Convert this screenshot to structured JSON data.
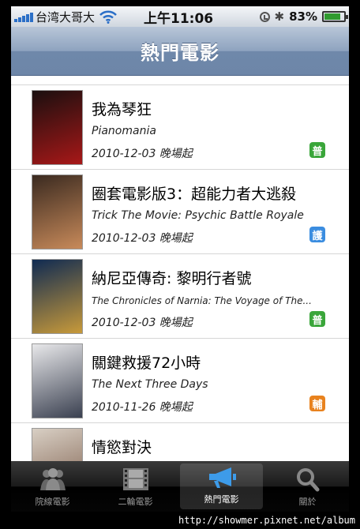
{
  "status_bar": {
    "carrier": "台湾大哥大",
    "time": "上午11:06",
    "battery_percent": "83%",
    "battery_level": 0.83
  },
  "nav": {
    "title": "熱門電影"
  },
  "movies": [
    {
      "title": "我為琴狂",
      "subtitle": "Pianomania",
      "date": "2010-12-03 晚場起",
      "rating": "普",
      "rating_color": "#3aa63a",
      "poster_colors": [
        "#1a0f0f",
        "#a81818"
      ]
    },
    {
      "title": "圈套電影版3：超能力者大逃殺",
      "subtitle": "Trick The Movie: Psychic Battle Royale",
      "date": "2010-12-03 晚場起",
      "rating": "護",
      "rating_color": "#3b8de0",
      "poster_colors": [
        "#3a2a20",
        "#c88a5a"
      ]
    },
    {
      "title": "納尼亞傳奇: 黎明行者號",
      "subtitle": "The Chronicles of Narnia: The Voyage of The...",
      "date": "2010-12-03 晚場起",
      "rating": "普",
      "rating_color": "#3aa63a",
      "poster_colors": [
        "#0f2a52",
        "#c89a3a"
      ]
    },
    {
      "title": "關鍵救援72小時",
      "subtitle": "The Next Three Days",
      "date": "2010-11-26 晚場起",
      "rating": "輔",
      "rating_color": "#e8821e",
      "poster_colors": [
        "#e8e8ea",
        "#3a4050"
      ]
    },
    {
      "title": "情慾對決",
      "subtitle": "",
      "date": "",
      "rating": "",
      "rating_color": "#999999",
      "poster_colors": [
        "#d8cfc4",
        "#7a5a48"
      ]
    }
  ],
  "tabs": [
    {
      "label": "院線電影",
      "icon": "people-icon",
      "active": false
    },
    {
      "label": "二輪電影",
      "icon": "film-strip-icon",
      "active": false
    },
    {
      "label": "熱門電影",
      "icon": "megaphone-icon",
      "active": true
    },
    {
      "label": "關於",
      "icon": "magnifier-icon",
      "active": false
    }
  ],
  "footer": {
    "url": "http://showmer.pixnet.net/album"
  }
}
